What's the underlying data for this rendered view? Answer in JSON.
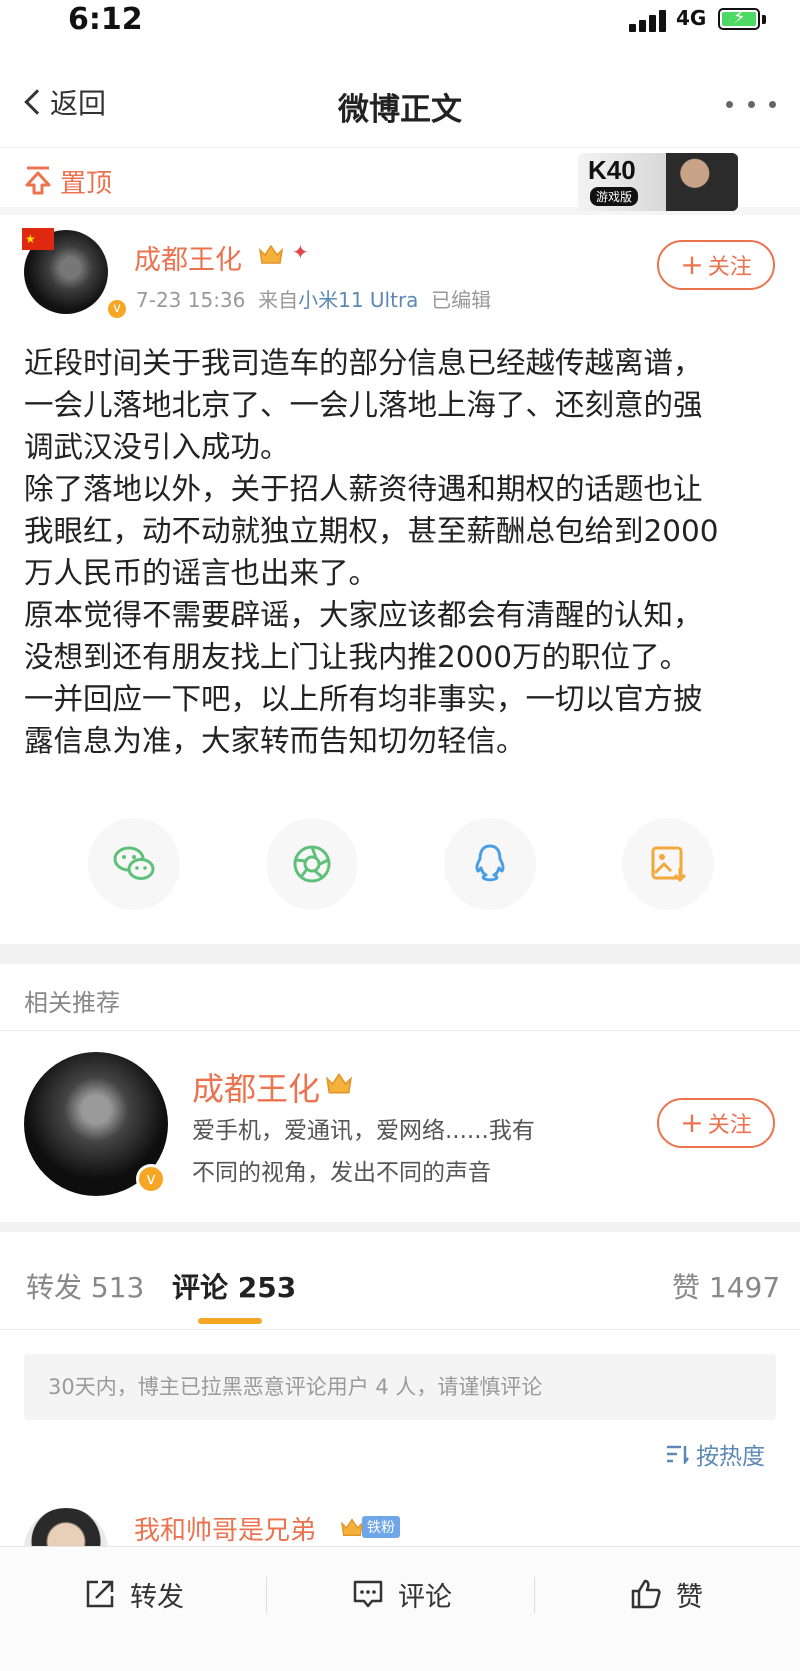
{
  "status": {
    "time": "6:12",
    "network": "4G"
  },
  "nav": {
    "back_label": "返回",
    "title": "微博正文"
  },
  "pin": {
    "label": "置顶"
  },
  "ad": {
    "title": "K40",
    "subtitle": "游戏版"
  },
  "post": {
    "author": "成都王化",
    "date": "7-23 15:36",
    "source_prefix": "来自",
    "source": "小米11 Ultra",
    "edited": "已编辑",
    "follow_label": "关注",
    "flag": "★",
    "lines": [
      "近段时间关于我司造车的部分信息已经越传越离谱，",
      "一会儿落地北京了、一会儿落地上海了、还刻意的强",
      "调武汉没引入成功。",
      "除了落地以外，关于招人薪资待遇和期权的话题也让",
      "我眼红，动不动就独立期权，甚至薪酬总包给到2000",
      "万人民币的谣言也出来了。",
      "原本觉得不需要辟谣，大家应该都会有清醒的认知，",
      "没想到还有朋友找上门让我内推2000万的职位了。",
      "一并回应一下吧，以上所有均非事实，一切以官方披",
      "露信息为准，大家转而告知切勿轻信。"
    ]
  },
  "share": {
    "icons": [
      "wechat-icon",
      "moments-icon",
      "qq-icon",
      "save-image-icon"
    ]
  },
  "related": {
    "title": "相关推荐",
    "name": "成都王化",
    "desc_line1": "爱手机，爱通讯，爱网络......我有",
    "desc_line2": "不同的视角，发出不同的声音",
    "follow_label": "关注"
  },
  "tabs": {
    "repost_label": "转发",
    "repost_count": "513",
    "comment_label": "评论",
    "comment_count": "253",
    "like_label": "赞",
    "like_count": "1497"
  },
  "notice": "30天内，博主已拉黑恶意评论用户 4 人，请谨慎评论",
  "sort_label": "按热度",
  "comment": {
    "user": "我和帅哥是兄弟",
    "fan_badge": "铁粉"
  },
  "toolbar": {
    "repost": "转发",
    "comment": "评论",
    "like": "赞"
  },
  "colors": {
    "accent": "#eb7350",
    "link": "#5d88b5",
    "tab_indicator": "#f5a623"
  }
}
